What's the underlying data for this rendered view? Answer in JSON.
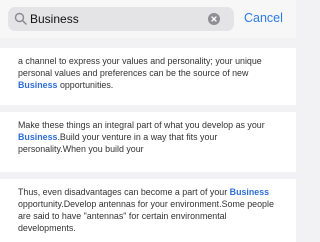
{
  "search": {
    "query": "Business",
    "placeholder": "Search",
    "cancel_label": "Cancel"
  },
  "results": [
    {
      "segments": [
        {
          "text": "a channel to express your values and personality; your unique personal values and preferences can be the source of new ",
          "highlight": false
        },
        {
          "text": " Business ",
          "highlight": true
        },
        {
          "text": " opportunities.",
          "highlight": false
        }
      ]
    },
    {
      "segments": [
        {
          "text": "Make these things an integral part of what you develop as your ",
          "highlight": false
        },
        {
          "text": "Business",
          "highlight": true
        },
        {
          "text": ".Build your venture in a way that fits your personality.When you build your",
          "highlight": false
        }
      ]
    },
    {
      "segments": [
        {
          "text": "Thus, even disadvantages can become a part of your ",
          "highlight": false
        },
        {
          "text": "Business",
          "highlight": true
        },
        {
          "text": " opportunity.Develop antennas for your environment.Some people are said to have \"antennas\" for certain environmental developments.",
          "highlight": false
        }
      ]
    }
  ],
  "colors": {
    "accent": "#2c7be5",
    "highlight": "#2f6fd6",
    "background": "#f2f2f4"
  },
  "icons": {
    "search": "search-icon",
    "clear": "clear-icon"
  }
}
